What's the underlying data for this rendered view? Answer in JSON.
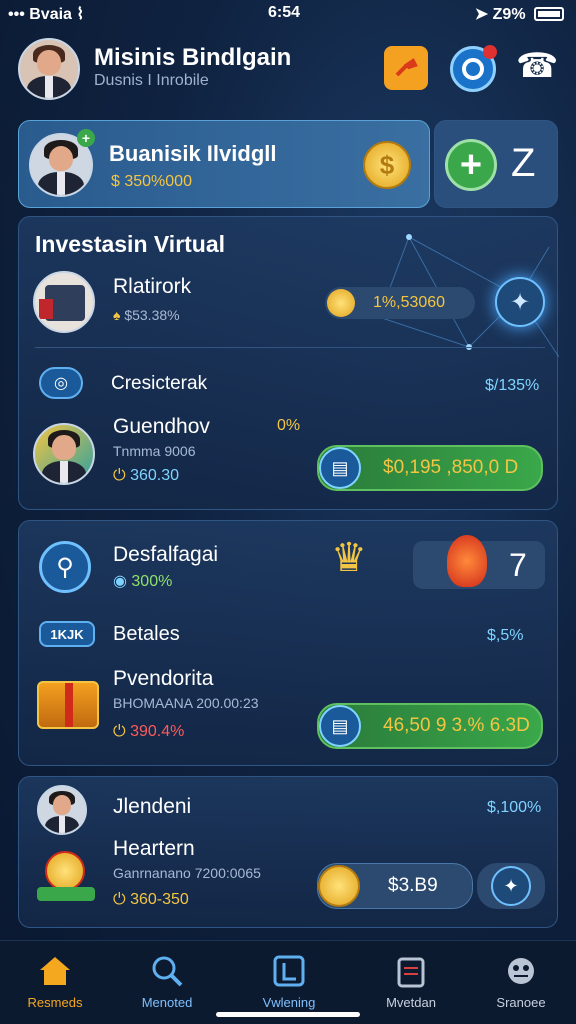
{
  "status": {
    "carrier": "Bvaia",
    "time": "6:54",
    "battery": "Z9%"
  },
  "header": {
    "title": "Misinis Bindlgain",
    "subtitle": "Dusnis I Inrobile"
  },
  "profile_card": {
    "name": "Buanisik Ilvidgll",
    "balance": "$ 350%000",
    "add_count": "Z"
  },
  "invest": {
    "title": "Investasin Virtual",
    "item1": {
      "name": "Rlatirork",
      "value": "$53.38%",
      "amount": "1%,53060"
    },
    "tag1": {
      "name": "Cresicterak",
      "value": "$/135%"
    },
    "item2": {
      "name": "Guendhov",
      "percent": "0%",
      "sub": "Tnmma 9006",
      "value": "360.30",
      "amount": "$0,195 ,850,0 D"
    }
  },
  "section2": {
    "item1": {
      "name": "Desfalfagai",
      "value": "300%",
      "count": "7"
    },
    "tag": {
      "badge": "1KJK",
      "name": "Betales",
      "value": "$,5%"
    },
    "item2": {
      "name": "Pvendorita",
      "sub": "BHOMAANA 200.00:23",
      "value": "390.4%",
      "amount": "46,50 9 3.% 6.3D"
    }
  },
  "section3": {
    "item1": {
      "name": "Jlendeni",
      "value": "$,100%"
    },
    "item2": {
      "name": "Heartern",
      "sub": "Ganrnanano 7200:0065",
      "value": "360-350",
      "amount": "$3.B9"
    }
  },
  "nav": [
    {
      "label": "Resmeds"
    },
    {
      "label": "Menoted"
    },
    {
      "label": "Vwlening"
    },
    {
      "label": "Mvetdan"
    },
    {
      "label": "Sranoee"
    }
  ],
  "colors": {
    "accent": "#f4c542",
    "active_nav": "#f4a820",
    "green": "#3aa84a"
  }
}
